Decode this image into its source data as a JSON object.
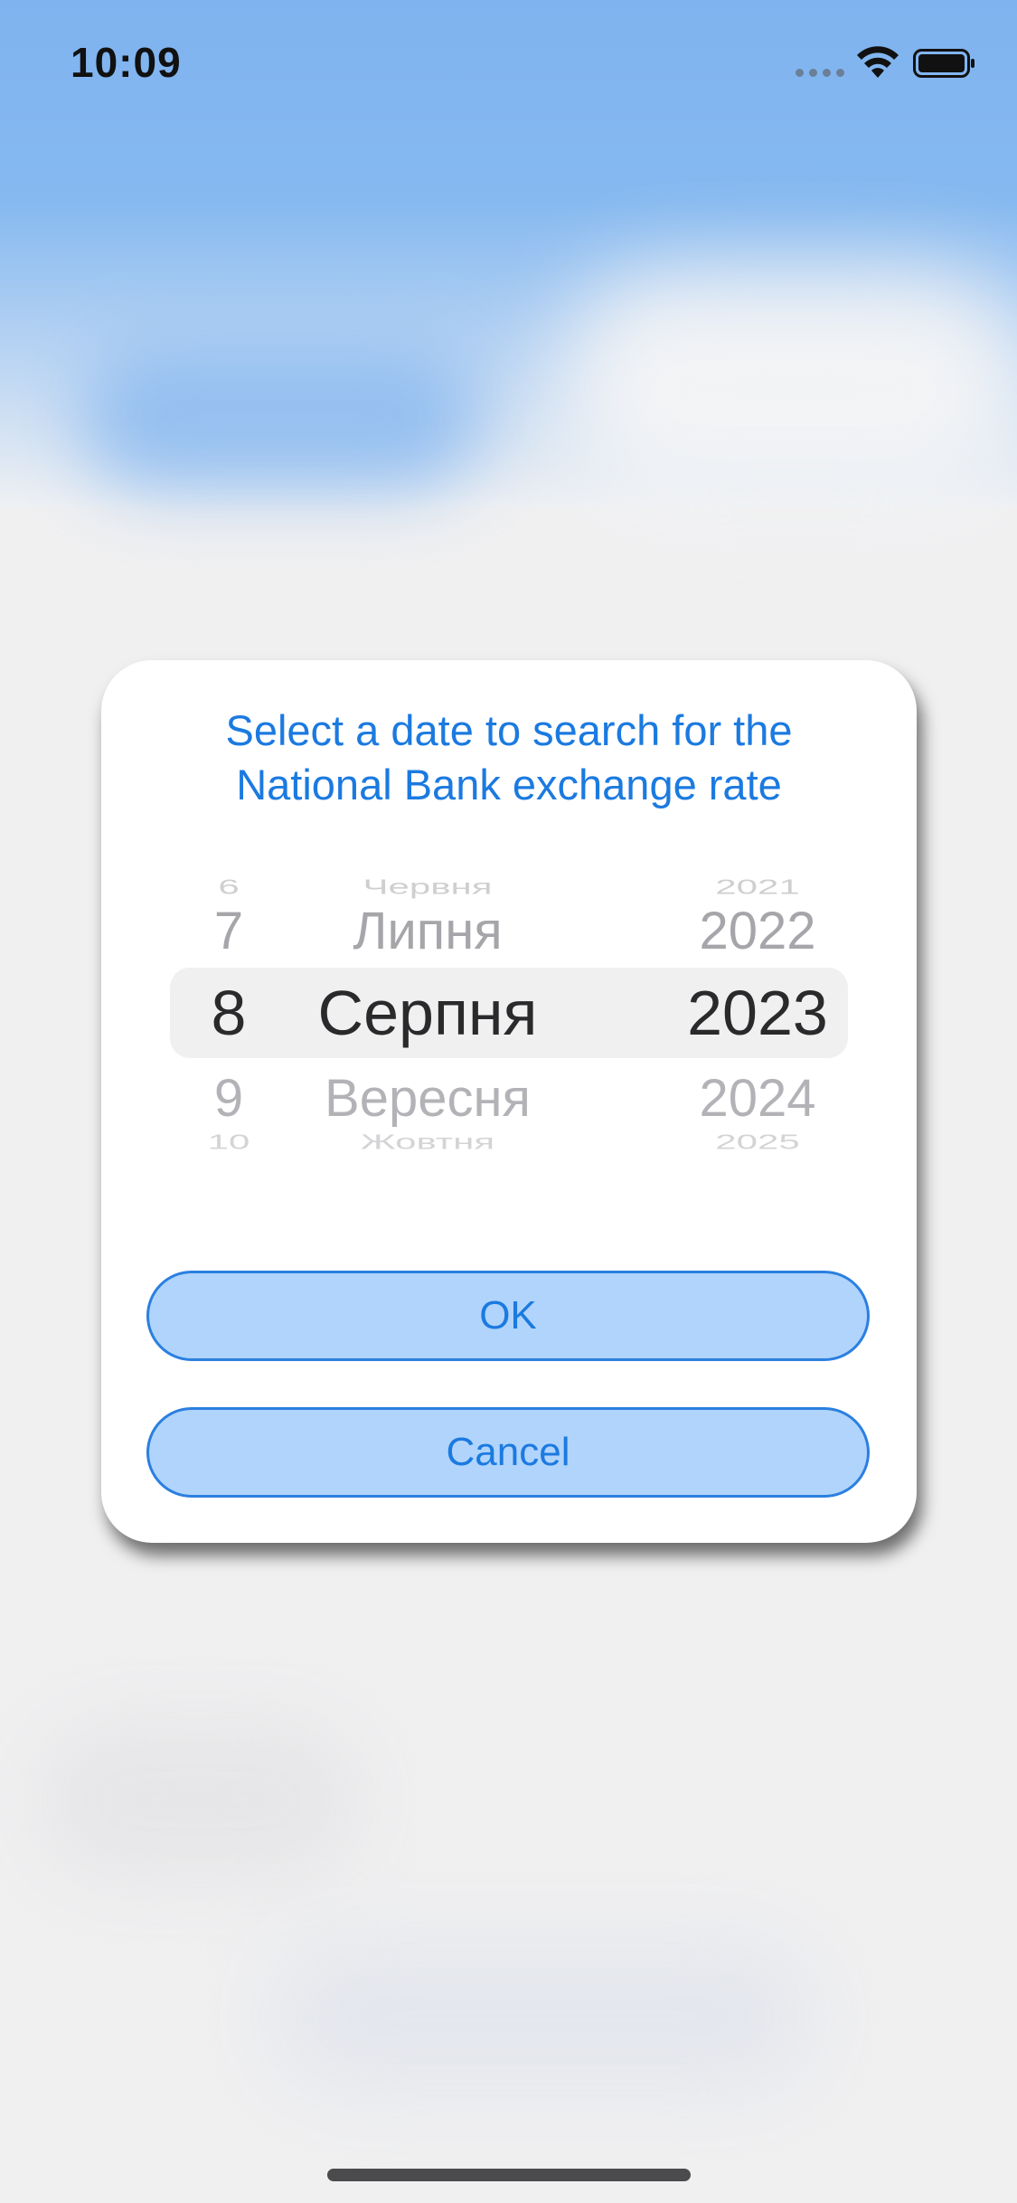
{
  "status_bar": {
    "time": "10:09"
  },
  "dialog": {
    "title_line1": "Select a date to search for the",
    "title_line2": "National Bank exchange rate",
    "picker": {
      "days": [
        "6",
        "7",
        "8",
        "9",
        "10"
      ],
      "months": [
        "Червня",
        "Липня",
        "Серпня",
        "Вересня",
        "Жовтня"
      ],
      "years": [
        "2021",
        "2022",
        "2023",
        "2024",
        "2025"
      ],
      "selected": {
        "day": "8",
        "month": "Серпня",
        "year": "2023"
      }
    },
    "ok_label": "OK",
    "cancel_label": "Cancel"
  },
  "colors": {
    "accent": "#1b7ae0",
    "button_fill": "#b0d4fb",
    "button_border": "#2b7fe0",
    "sky": "#7fb3ef"
  }
}
